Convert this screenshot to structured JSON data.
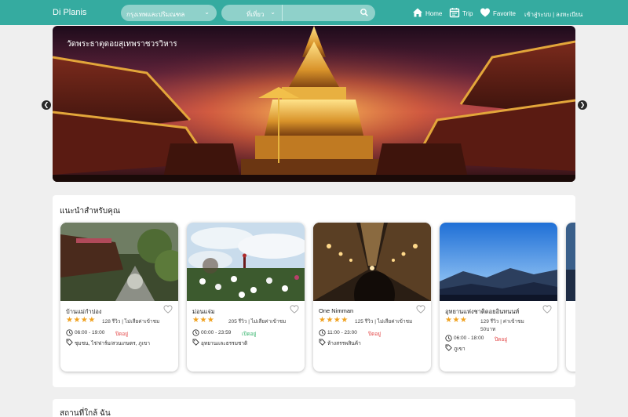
{
  "header": {
    "brand": "Di Planis",
    "province": "กรุงเทพและปริมณฑล",
    "category": "ที่เที่ยว",
    "search_placeholder": "",
    "nav": {
      "home": "Home",
      "trip": "Trip",
      "favorite": "Favorite"
    },
    "auth": "เข้าสู่ระบบ | ลงทะเบียน"
  },
  "hero": {
    "caption": "วัดพระธาตุดอยสุเทพราชวรวิหาร"
  },
  "recommend": {
    "title": "แนะนำสำหรับคุณ",
    "cards": [
      {
        "name": "บ้านแม่กำปอง",
        "rating": 4,
        "reviews": "128 รีวิว | ไม่เสียค่าเข้าชม",
        "price_extra": "",
        "hours": "06:00 - 19:00",
        "status": "ปิดอยู่",
        "status_color": "#e34848",
        "tags": "ชุมชน, ไร่/ฟาร์ม/สวนเกษตร, ภูเขา"
      },
      {
        "name": "ม่อนแจ่ม",
        "rating": 3,
        "reviews": "205 รีวิว | ไม่เสียค่าเข้าชม",
        "price_extra": "",
        "hours": "00:00 - 23:59",
        "status": "เปิดอยู่",
        "status_color": "#32b36a",
        "tags": "อุทยานและธรรมชาติ"
      },
      {
        "name": "One Nimman",
        "rating": 4,
        "reviews": "125 รีวิว | ไม่เสียค่าเข้าชม",
        "price_extra": "",
        "hours": "11:00 - 23:00",
        "status": "ปิดอยู่",
        "status_color": "#e34848",
        "tags": "ห้างสรรพสินค้า"
      },
      {
        "name": "อุทยานแห่งชาติดอยอินทนนท์",
        "rating": 3,
        "reviews": "129 รีวิว | ค่าเข้าชม",
        "price_extra": "50บาท",
        "hours": "06:00 - 18:00",
        "status": "ปิดอยู่",
        "status_color": "#e34848",
        "tags": "ภูเขา"
      }
    ]
  },
  "nearby": {
    "title": "สถานที่ใกล้ ฉัน"
  },
  "colors": {
    "topbar": "#35aba0",
    "star": "#f0a11f",
    "open": "#32b36a",
    "closed": "#e34848"
  }
}
